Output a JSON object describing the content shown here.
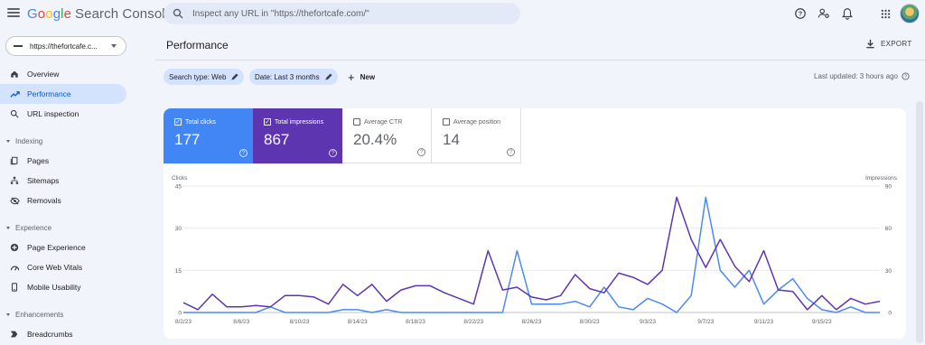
{
  "header": {
    "logo": {
      "G": "G",
      "o1": "o",
      "o2": "o",
      "g": "g",
      "l": "l",
      "e": "e",
      "product": "Search Console"
    },
    "search_placeholder": "Inspect any URL in \"https://thefortcafe.com/\"",
    "icons": [
      "menu-icon",
      "help-icon",
      "manage-users-icon",
      "notifications-icon",
      "apps-grid-icon",
      "avatar"
    ]
  },
  "sidebar": {
    "property": "https://thefortcafe.c...",
    "items": [
      {
        "label": "Overview",
        "icon": "home-icon"
      },
      {
        "label": "Performance",
        "icon": "trending-up-icon",
        "active": true
      },
      {
        "label": "URL inspection",
        "icon": "search-icon"
      }
    ],
    "indexing": {
      "title": "Indexing",
      "items": [
        {
          "label": "Pages",
          "icon": "pages-icon"
        },
        {
          "label": "Sitemaps",
          "icon": "sitemaps-icon"
        },
        {
          "label": "Removals",
          "icon": "removals-icon"
        }
      ]
    },
    "experience": {
      "title": "Experience",
      "items": [
        {
          "label": "Page Experience",
          "icon": "page-experience-icon"
        },
        {
          "label": "Core Web Vitals",
          "icon": "speed-icon"
        },
        {
          "label": "Mobile Usability",
          "icon": "phone-icon"
        }
      ]
    },
    "enhancements": {
      "title": "Enhancements",
      "items": [
        {
          "label": "Breadcrumbs",
          "icon": "breadcrumbs-icon"
        }
      ]
    }
  },
  "main": {
    "title": "Performance",
    "export_label": "EXPORT",
    "filters": {
      "search_type": "Search type: Web",
      "date": "Date: Last 3 months",
      "new_label": "New"
    },
    "last_updated": "Last updated: 3 hours ago"
  },
  "metrics": [
    {
      "label": "Total clicks",
      "value": "177",
      "checked": true,
      "color": "#4285f4"
    },
    {
      "label": "Total impressions",
      "value": "867",
      "checked": true,
      "color": "#5e35b1"
    },
    {
      "label": "Average CTR",
      "value": "20.4%",
      "checked": false
    },
    {
      "label": "Average position",
      "value": "14",
      "checked": false
    }
  ],
  "chart_data": {
    "type": "line",
    "left_axis_label": "Clicks",
    "right_axis_label": "Impressions",
    "left_ylim": [
      0,
      45
    ],
    "right_ylim": [
      0,
      90
    ],
    "left_ticks": [
      "0",
      "15",
      "30",
      "45"
    ],
    "right_ticks": [
      "0",
      "30",
      "60",
      "90"
    ],
    "x_tick_labels": [
      "8/2/23",
      "8/6/23",
      "8/10/23",
      "8/14/23",
      "8/18/23",
      "8/22/23",
      "8/26/23",
      "8/30/23",
      "9/3/23",
      "9/7/23",
      "9/11/23",
      "9/15/23"
    ],
    "grid": true,
    "series": [
      {
        "name": "Clicks",
        "axis": "left",
        "color": "#4a8af4",
        "values": [
          0,
          0,
          0,
          0,
          0,
          0,
          2,
          0,
          0,
          0,
          0,
          1,
          1,
          0,
          1,
          0,
          0,
          0,
          0,
          0,
          0,
          0,
          0,
          22,
          3,
          3,
          3,
          4,
          2,
          9,
          2,
          1,
          5,
          3,
          0,
          6,
          41,
          15,
          9,
          15,
          3,
          8,
          12,
          5,
          1,
          0,
          2,
          0,
          0
        ]
      },
      {
        "name": "Impressions",
        "axis": "right",
        "color": "#5e35b1",
        "values": [
          7,
          2,
          13,
          4,
          4,
          5,
          4,
          12,
          12,
          11,
          6,
          20,
          12,
          20,
          8,
          16,
          19,
          19,
          14,
          10,
          6,
          44,
          16,
          18,
          11,
          9,
          12,
          27,
          17,
          14,
          28,
          25,
          20,
          30,
          82,
          52,
          32,
          52,
          33,
          22,
          44,
          16,
          15,
          2,
          12,
          2,
          10,
          6,
          8
        ]
      }
    ]
  }
}
